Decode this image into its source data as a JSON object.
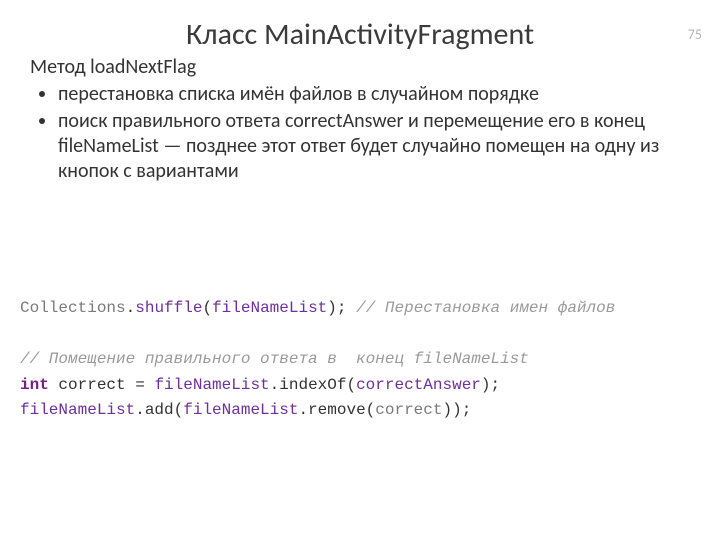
{
  "page_number": "75",
  "title": "Класс MainActivityFragment",
  "subhead": "Метод loadNextFlag",
  "bullets": [
    "перестановка списка имён файлов в случайном порядке",
    "поиск правильного ответа correctAnswer и перемещение его в конец fileNameList — позднее этот ответ будет случайно помещен на одну из кнопок с вариантами"
  ],
  "code": {
    "l1": {
      "a": "Collections",
      "b": ".",
      "c": "shuffle",
      "d": "(",
      "e": "fileNameList",
      "f": ");",
      "g": " // Перестановка имен файлов"
    },
    "l2": "",
    "l3": "// Помещение правильного ответа в  конец fileNameList",
    "l4": {
      "a": "int",
      "b": " correct = ",
      "c": "fileNameList",
      "d": ".indexOf(",
      "e": "correctAnswer",
      "f": ");"
    },
    "l5": {
      "a": "fileNameList",
      "b": ".add(",
      "c": "fileNameList",
      "d": ".remove(",
      "e": "correct",
      "f": "));"
    }
  }
}
